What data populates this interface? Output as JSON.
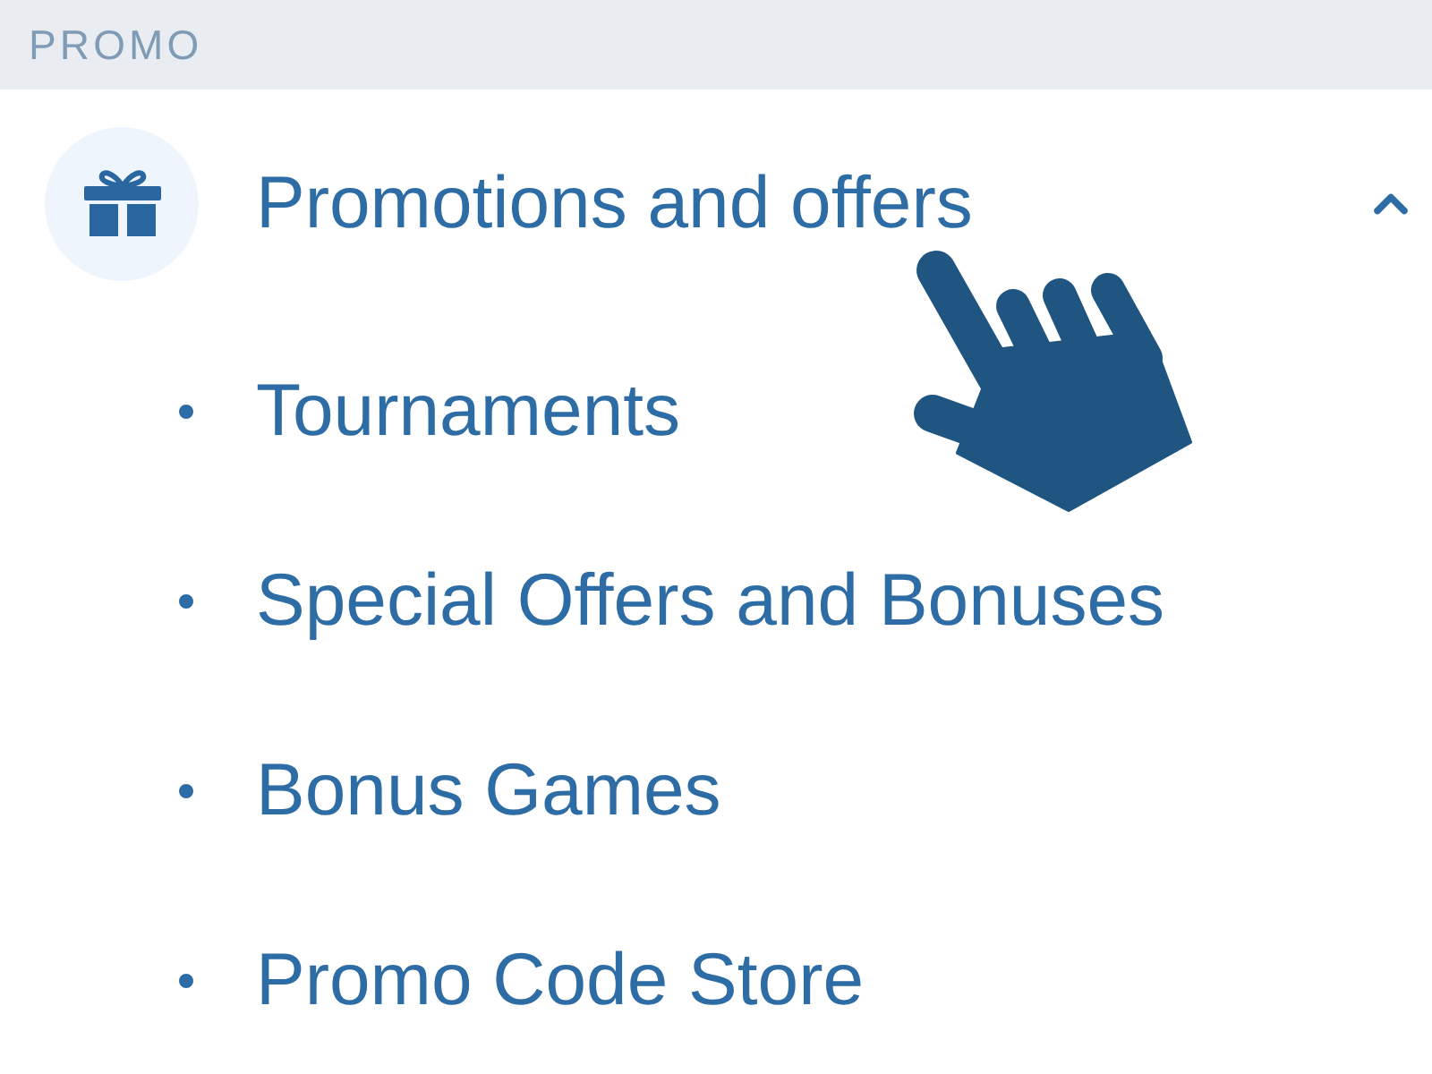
{
  "section": {
    "title": "PROMO"
  },
  "menu": {
    "label": "Promotions and offers",
    "expanded": true,
    "children": [
      {
        "label": "Tournaments"
      },
      {
        "label": "Special Offers and Bonuses"
      },
      {
        "label": "Bonus Games"
      },
      {
        "label": "Promo Code Store"
      }
    ]
  }
}
